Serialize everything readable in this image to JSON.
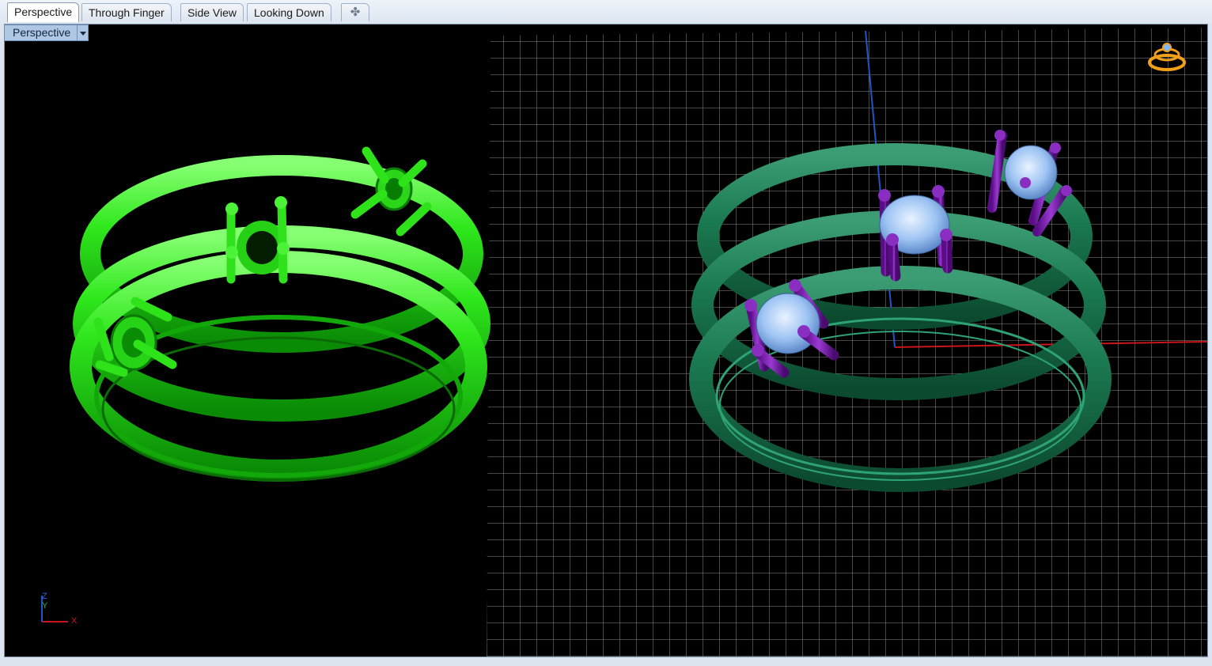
{
  "tabs": [
    {
      "label": "Perspective",
      "active": true
    },
    {
      "label": "Through Finger",
      "active": false
    },
    {
      "label": "Side View",
      "active": false
    },
    {
      "label": "Looking Down",
      "active": false
    }
  ],
  "add_tab_icon": "plus-icon",
  "viewport": {
    "title": "Perspective",
    "dropdown_icon": "chevron-down-icon",
    "axis_widget": {
      "z": "Z",
      "y": "Y",
      "x": "X"
    },
    "navigation_icon": "ring-nav-icon"
  },
  "colors": {
    "viewport_bg": "#000000",
    "grid": "#9a9a9a",
    "bright_green_ring": "#22d312",
    "dark_green_ring": "#1a7a4e",
    "prong_purple": "#7a1fa8",
    "gem_blue": "#9cc4f2",
    "axis_x": "#c8161c",
    "axis_y": "#1f56c8",
    "nav_icon": "#f2a018"
  }
}
